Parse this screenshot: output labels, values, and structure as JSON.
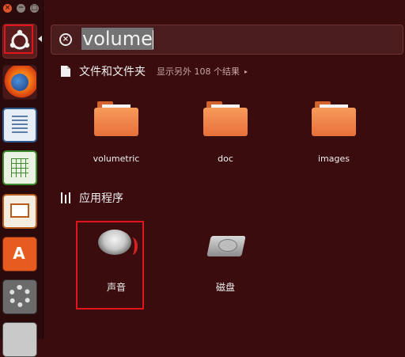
{
  "window_controls": {
    "close": "×",
    "minimize": "−",
    "maximize": "□"
  },
  "search": {
    "query": "volume",
    "clear_glyph": "×"
  },
  "files_section": {
    "title": "文件和文件夹",
    "more": "显示另外 108 个结果",
    "more_arrow": "▸",
    "icon": "document-icon",
    "items": [
      {
        "label": "volumetric",
        "icon": "folder-icon"
      },
      {
        "label": "doc",
        "icon": "folder-icon"
      },
      {
        "label": "images",
        "icon": "folder-icon"
      }
    ]
  },
  "apps_section": {
    "title": "应用程序",
    "icon": "apps-icon",
    "items": [
      {
        "label": "声音",
        "icon": "volume-knob-icon"
      },
      {
        "label": "磁盘",
        "icon": "disk-icon"
      }
    ]
  },
  "launcher": {
    "items": [
      "dash-home",
      "firefox",
      "libreoffice-writer",
      "libreoffice-calc",
      "libreoffice-impress",
      "ubuntu-software",
      "system-settings",
      "text-editor"
    ]
  },
  "colors": {
    "background": "#3a0c0e",
    "highlight_box": "#e1141c",
    "folder": "#e8703a"
  }
}
